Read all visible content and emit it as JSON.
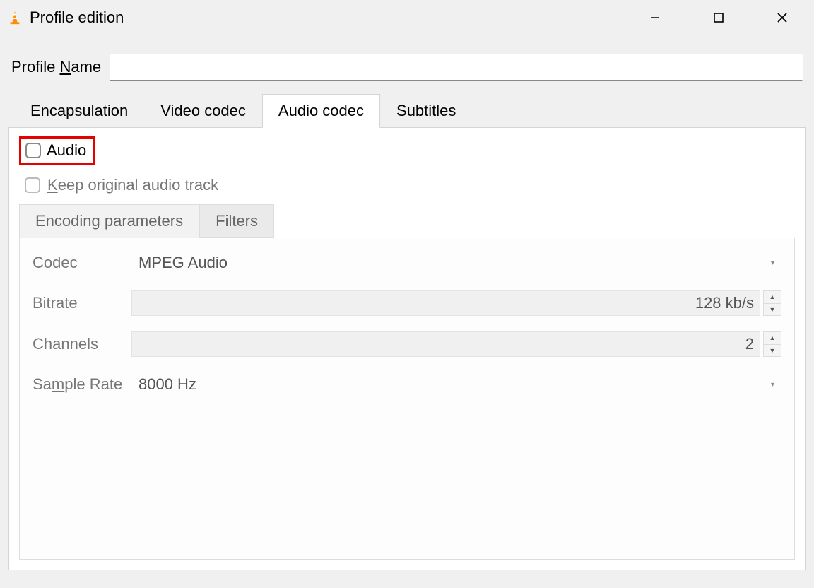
{
  "window": {
    "title": "Profile edition"
  },
  "profile": {
    "label_pre": "Profile ",
    "label_ul": "N",
    "label_post": "ame",
    "value": ""
  },
  "tabs": {
    "encapsulation": "Encapsulation",
    "video_codec": "Video codec",
    "audio_codec": "Audio codec",
    "subtitles": "Subtitles"
  },
  "audio": {
    "group_label": "Audio",
    "keep_pre": "",
    "keep_ul": "K",
    "keep_post": "eep original audio track",
    "subtabs": {
      "encoding": "Encoding parameters",
      "filters": "Filters"
    },
    "fields": {
      "codec_label": "Codec",
      "codec_value": "MPEG Audio",
      "bitrate_label": "Bitrate",
      "bitrate_value": "128 kb/s",
      "channels_label": "Channels",
      "channels_value": "2",
      "sample_pre": "Sa",
      "sample_ul": "m",
      "sample_post": "ple Rate",
      "sample_value": "8000 Hz"
    }
  }
}
